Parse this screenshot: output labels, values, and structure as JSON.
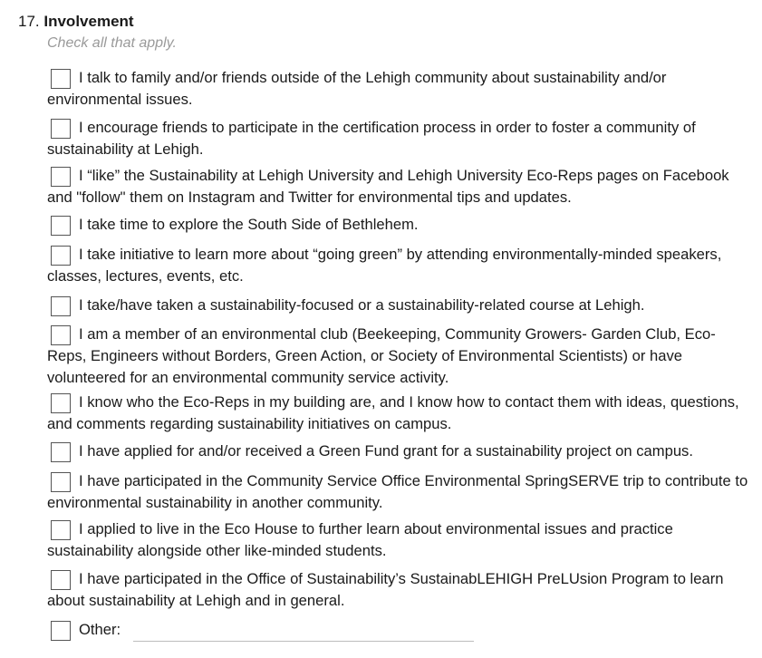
{
  "question": {
    "number": "17.",
    "label": "Involvement",
    "hint": "Check all that apply."
  },
  "options": [
    "I talk to family and/or friends outside of the Lehigh community about sustainability and/or environmental issues.",
    "I encourage friends to participate in the certification process in order to foster a community of sustainability at Lehigh.",
    "I “like” the Sustainability at Lehigh University and Lehigh University Eco-Reps pages on Facebook and \"follow\" them on Instagram and Twitter for environmental tips and updates.",
    "I take time to explore the South Side of Bethlehem.",
    "I take initiative to learn more about “going green” by attending environmentally-minded speakers, classes, lectures, events, etc.",
    "I take/have taken a sustainability-focused or a sustainability-related course at Lehigh.",
    "I am a member of an environmental club (Beekeeping, Community Growers- Garden Club, Eco-Reps, Engineers without Borders, Green Action, or Society of Environmental Scientists) or have volunteered for an environmental community service activity.",
    "I know who the Eco-Reps in my building are, and I know how to contact them with ideas, questions, and comments regarding sustainability initiatives on campus.",
    "I have applied for and/or received a Green Fund grant for a sustainability project on campus.",
    "I have participated in the Community Service Office Environmental SpringSERVE trip to contribute to environmental sustainability in another community.",
    "I applied to live in the Eco House to further learn about environmental issues and practice sustainability alongside other like-minded students.",
    "I have participated in the Office of Sustainability’s SustainabLEHIGH PreLUsion Program to learn about sustainability at Lehigh and in general.",
    "Other:"
  ],
  "other_value": ""
}
